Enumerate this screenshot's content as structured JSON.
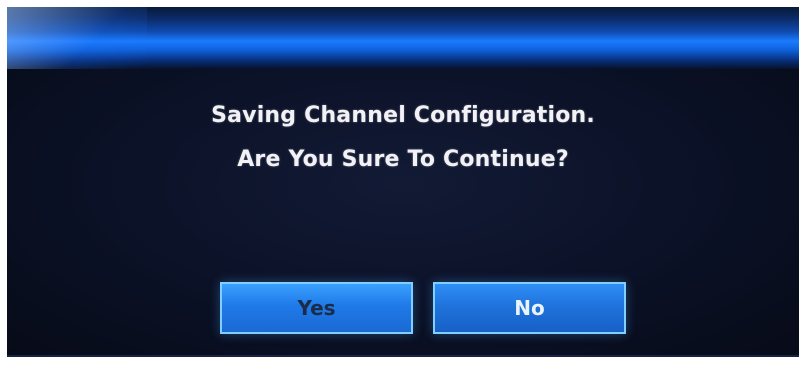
{
  "dialog": {
    "line1": "Saving Channel Configuration.",
    "line2": "Are You Sure To Continue?",
    "buttons": {
      "yes": "Yes",
      "no": "No"
    }
  },
  "colors": {
    "title_bar": "#1a7bff",
    "background": "#0b0f1e",
    "button": "#1f73db",
    "button_border": "#7fd0ff",
    "text": "#f1f1f6"
  }
}
